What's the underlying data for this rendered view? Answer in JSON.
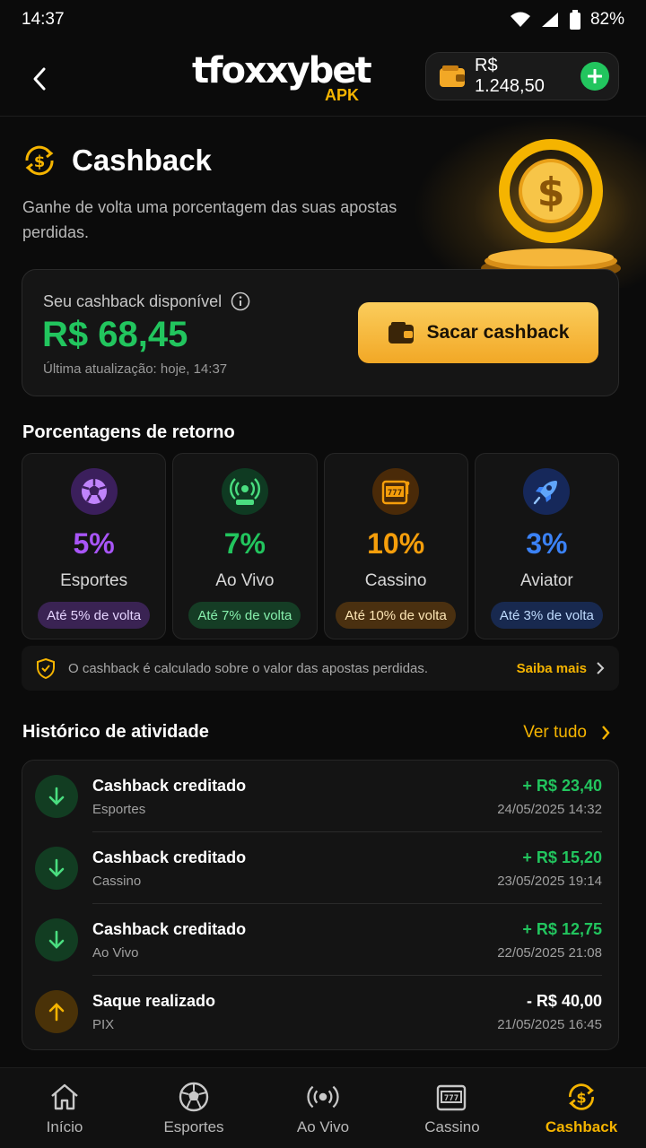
{
  "status_bar": {
    "time": "14:37",
    "battery": "82%"
  },
  "header": {
    "logo_main": "tfoxxybet",
    "logo_sub": "APK",
    "balance": "R$ 1.248,50"
  },
  "hero": {
    "title": "Cashback",
    "description": "Ganhe de volta uma porcentagem das suas apostas perdidas."
  },
  "cashback_card": {
    "label": "Seu cashback disponível",
    "amount": "R$ 68,45",
    "updated": "Última atualização: hoje, 14:37",
    "withdraw_label": "Sacar cashback"
  },
  "percentages": {
    "title": "Porcentagens de retorno",
    "items": [
      {
        "value": "5%",
        "name": "Esportes",
        "badge": "Até 5% de volta",
        "icon": "soccer-ball-icon",
        "color": "#a855f7"
      },
      {
        "value": "7%",
        "name": "Ao Vivo",
        "badge": "Até 7% de volta",
        "icon": "live-broadcast-icon",
        "color": "#22c55e"
      },
      {
        "value": "10%",
        "name": "Cassino",
        "badge": "Até 10% de volta",
        "icon": "slot-machine-icon",
        "color": "#f59e0b"
      },
      {
        "value": "3%",
        "name": "Aviator",
        "badge": "Até 3% de volta",
        "icon": "rocket-icon",
        "color": "#3b82f6"
      }
    ]
  },
  "info_bar": {
    "text": "O cashback é calculado sobre o valor das apostas perdidas.",
    "link": "Saiba mais"
  },
  "history": {
    "title": "Histórico de atividade",
    "see_all": "Ver tudo",
    "rows": [
      {
        "title": "Cashback creditado",
        "sub": "Esportes",
        "amount": "+ R$ 23,40",
        "date": "24/05/2025 14:32",
        "type": "credit"
      },
      {
        "title": "Cashback creditado",
        "sub": "Cassino",
        "amount": "+ R$ 15,20",
        "date": "23/05/2025 19:14",
        "type": "credit"
      },
      {
        "title": "Cashback creditado",
        "sub": "Ao Vivo",
        "amount": "+ R$ 12,75",
        "date": "22/05/2025 21:08",
        "type": "credit"
      },
      {
        "title": "Saque realizado",
        "sub": "PIX",
        "amount": "- R$ 40,00",
        "date": "21/05/2025 16:45",
        "type": "withdraw"
      }
    ]
  },
  "bottom_nav": {
    "items": [
      {
        "label": "Início",
        "icon": "home-icon"
      },
      {
        "label": "Esportes",
        "icon": "soccer-ball-icon"
      },
      {
        "label": "Ao Vivo",
        "icon": "live-broadcast-icon"
      },
      {
        "label": "Cassino",
        "icon": "slot-machine-icon"
      },
      {
        "label": "Cashback",
        "icon": "cashback-icon",
        "active": true
      }
    ]
  },
  "colors": {
    "accent": "#f5b400",
    "positive": "#22c55e",
    "background": "#0b0b0b"
  }
}
